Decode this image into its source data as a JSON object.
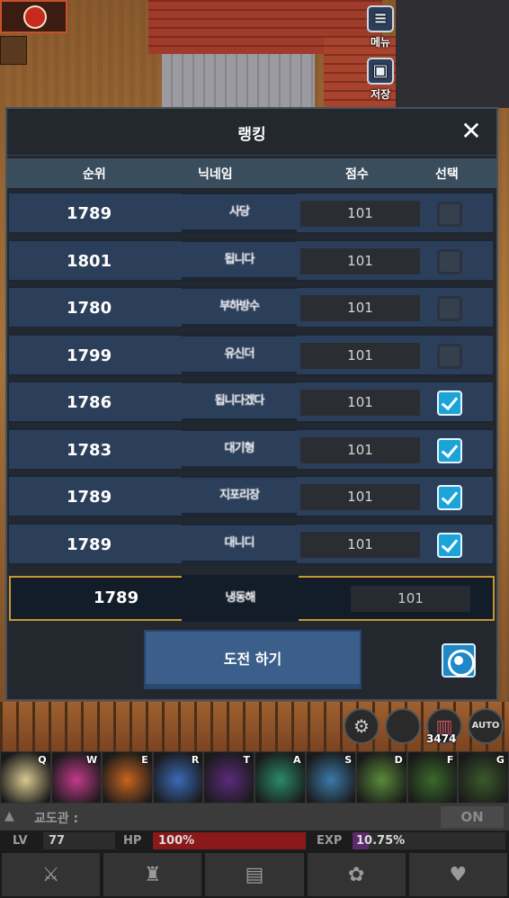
{
  "hud": {
    "menu_label": "메뉴",
    "save_label": "저장"
  },
  "ranking": {
    "title": "랭킹",
    "columns": {
      "rank": "순위",
      "nickname": "닉네임",
      "score": "점수",
      "select": "선택"
    },
    "rows": [
      {
        "rank": "1789",
        "nickname": "사당",
        "score": "101",
        "selected": false
      },
      {
        "rank": "1801",
        "nickname": "됩니다",
        "score": "101",
        "selected": false
      },
      {
        "rank": "1780",
        "nickname": "부하방수",
        "score": "101",
        "selected": false
      },
      {
        "rank": "1799",
        "nickname": "유신더",
        "score": "101",
        "selected": false
      },
      {
        "rank": "1786",
        "nickname": "됩니다겠다",
        "score": "101",
        "selected": true
      },
      {
        "rank": "1783",
        "nickname": "대기형",
        "score": "101",
        "selected": true
      },
      {
        "rank": "1789",
        "nickname": "지포리장",
        "score": "101",
        "selected": true
      },
      {
        "rank": "1789",
        "nickname": "대니디",
        "score": "101",
        "selected": true
      }
    ],
    "my_row": {
      "rank": "1789",
      "nickname": "냉동해",
      "score": "101"
    },
    "challenge_label": "도전 하기"
  },
  "skills": [
    {
      "key": "Q",
      "color": "#d8c890"
    },
    {
      "key": "W",
      "color": "#c23a8a"
    },
    {
      "key": "E",
      "color": "#c8641e"
    },
    {
      "key": "R",
      "color": "#3a6ab8"
    },
    {
      "key": "T",
      "color": "#5a2a7a"
    },
    {
      "key": "A",
      "color": "#2a8a6a"
    },
    {
      "key": "S",
      "color": "#3a7aa8"
    },
    {
      "key": "D",
      "color": "#5a8a3a"
    },
    {
      "key": "F",
      "color": "#3a6a2a"
    },
    {
      "key": "G",
      "color": "#3a5a2a"
    }
  ],
  "potion_count": "3474",
  "auto_label": "AUTO",
  "chat": {
    "label": "교도관 :",
    "toggle": "ON"
  },
  "stats": {
    "lv_label": "LV",
    "lv_value": "77",
    "hp_label": "HP",
    "hp_value": "100%",
    "hp_fraction": 1.0,
    "exp_label": "EXP",
    "exp_value": "10.75%",
    "exp_fraction": 0.1075
  },
  "nav": [
    "sword-icon",
    "armor-icon",
    "scroll-icon",
    "pet-icon",
    "heart-icon"
  ]
}
